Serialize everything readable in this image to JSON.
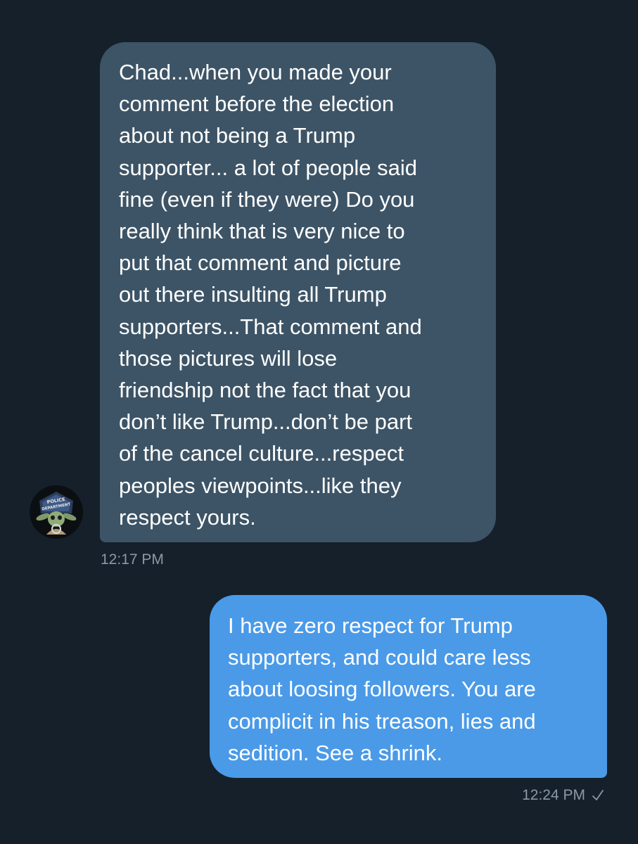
{
  "conversation": {
    "messages": [
      {
        "direction": "received",
        "text": "Chad...when you made your\ncomment before the election\nabout not being a Trump\nsupporter... a lot of people said\nfine (even if they were) Do you\nreally think that is very nice to\nput that comment and picture\nout there insulting all Trump\nsupporters...That comment and\nthose pictures will lose\nfriendship not the fact that you\ndon’t like Trump...don’t be part\nof the cancel culture...respect\npeoples viewpoints...like they\nrespect yours.",
        "time": "12:17 PM",
        "avatar": {
          "icon": "police-baby-yoda-avatar-icon",
          "badge_line1": "POLICE",
          "badge_line2": "DEPARTMENT"
        }
      },
      {
        "direction": "sent",
        "text": "I have zero respect for Trump\nsupporters, and could care less\nabout loosing followers. You are\ncomplicit in his treason, lies and\nsedition.  See a shrink.",
        "time": "12:24 PM",
        "status_icon": "checkmark-icon"
      }
    ]
  },
  "colors": {
    "background": "#15202b",
    "received_bubble": "#3d5466",
    "sent_bubble": "#4a9ae8",
    "timestamp": "#8b98a5",
    "message_text": "#ffffff"
  }
}
